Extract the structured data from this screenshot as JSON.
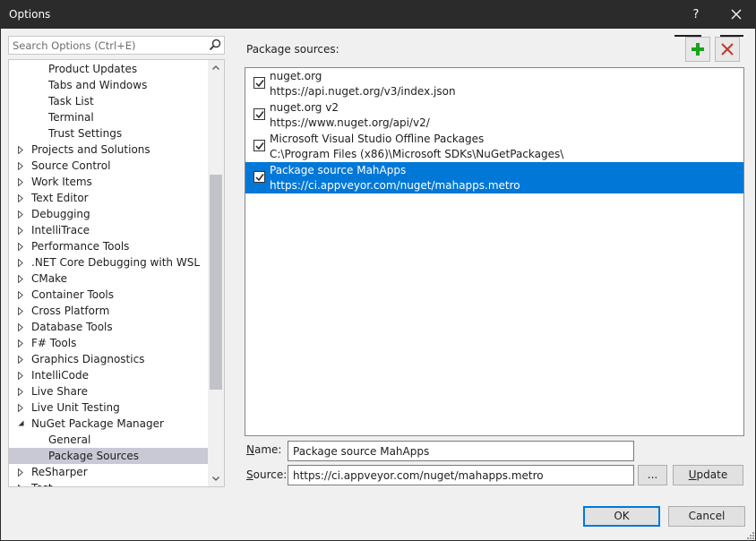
{
  "window": {
    "title": "Options",
    "help_label": "?"
  },
  "search": {
    "placeholder": "Search Options (Ctrl+E)"
  },
  "tree": {
    "items": [
      {
        "label": "Product Updates",
        "level": 2,
        "expander": "none"
      },
      {
        "label": "Tabs and Windows",
        "level": 2,
        "expander": "none"
      },
      {
        "label": "Task List",
        "level": 2,
        "expander": "none"
      },
      {
        "label": "Terminal",
        "level": 2,
        "expander": "none"
      },
      {
        "label": "Trust Settings",
        "level": 2,
        "expander": "none"
      },
      {
        "label": "Projects and Solutions",
        "level": 1,
        "expander": "collapsed"
      },
      {
        "label": "Source Control",
        "level": 1,
        "expander": "collapsed"
      },
      {
        "label": "Work Items",
        "level": 1,
        "expander": "collapsed"
      },
      {
        "label": "Text Editor",
        "level": 1,
        "expander": "collapsed"
      },
      {
        "label": "Debugging",
        "level": 1,
        "expander": "collapsed"
      },
      {
        "label": "IntelliTrace",
        "level": 1,
        "expander": "collapsed"
      },
      {
        "label": "Performance Tools",
        "level": 1,
        "expander": "collapsed"
      },
      {
        "label": ".NET Core Debugging with WSL",
        "level": 1,
        "expander": "collapsed"
      },
      {
        "label": "CMake",
        "level": 1,
        "expander": "collapsed"
      },
      {
        "label": "Container Tools",
        "level": 1,
        "expander": "collapsed"
      },
      {
        "label": "Cross Platform",
        "level": 1,
        "expander": "collapsed"
      },
      {
        "label": "Database Tools",
        "level": 1,
        "expander": "collapsed"
      },
      {
        "label": "F# Tools",
        "level": 1,
        "expander": "collapsed"
      },
      {
        "label": "Graphics Diagnostics",
        "level": 1,
        "expander": "collapsed"
      },
      {
        "label": "IntelliCode",
        "level": 1,
        "expander": "collapsed"
      },
      {
        "label": "Live Share",
        "level": 1,
        "expander": "collapsed"
      },
      {
        "label": "Live Unit Testing",
        "level": 1,
        "expander": "collapsed"
      },
      {
        "label": "NuGet Package Manager",
        "level": 1,
        "expander": "expanded"
      },
      {
        "label": "General",
        "level": 2,
        "expander": "none"
      },
      {
        "label": "Package Sources",
        "level": 2,
        "expander": "none",
        "selected": true
      },
      {
        "label": "ReSharper",
        "level": 1,
        "expander": "collapsed"
      },
      {
        "label": "Test",
        "level": 1,
        "expander": "collapsed"
      }
    ]
  },
  "package_sources": {
    "label": "Package sources:",
    "items": [
      {
        "name": "nuget.org",
        "url": "https://api.nuget.org/v3/index.json",
        "checked": true,
        "selected": false
      },
      {
        "name": "nuget.org v2",
        "url": "https://www.nuget.org/api/v2/",
        "checked": true,
        "selected": false
      },
      {
        "name": "Microsoft Visual Studio Offline Packages",
        "url": "C:\\Program Files (x86)\\Microsoft SDKs\\NuGetPackages\\",
        "checked": true,
        "selected": false
      },
      {
        "name": "Package source MahApps",
        "url": "https://ci.appveyor.com/nuget/mahapps.metro",
        "checked": true,
        "selected": true
      }
    ]
  },
  "form": {
    "name_label_key": "N",
    "name_label_rest": "ame:",
    "name_value": "Package source MahApps",
    "source_label_key": "S",
    "source_label_rest": "ource:",
    "source_value": "https://ci.appveyor.com/nuget/mahapps.metro",
    "browse_label": "...",
    "update_label_key": "U",
    "update_label_rest": "pdate"
  },
  "footer": {
    "ok_label": "OK",
    "cancel_label": "Cancel"
  },
  "colors": {
    "titlebar": "#2b2b2b",
    "selection": "#0078d7",
    "add_icon": "#1aa31a",
    "remove_icon": "#c0392b"
  },
  "icons": {
    "search": "search-icon",
    "add": "plus-icon",
    "remove": "x-icon",
    "close": "close-icon"
  }
}
